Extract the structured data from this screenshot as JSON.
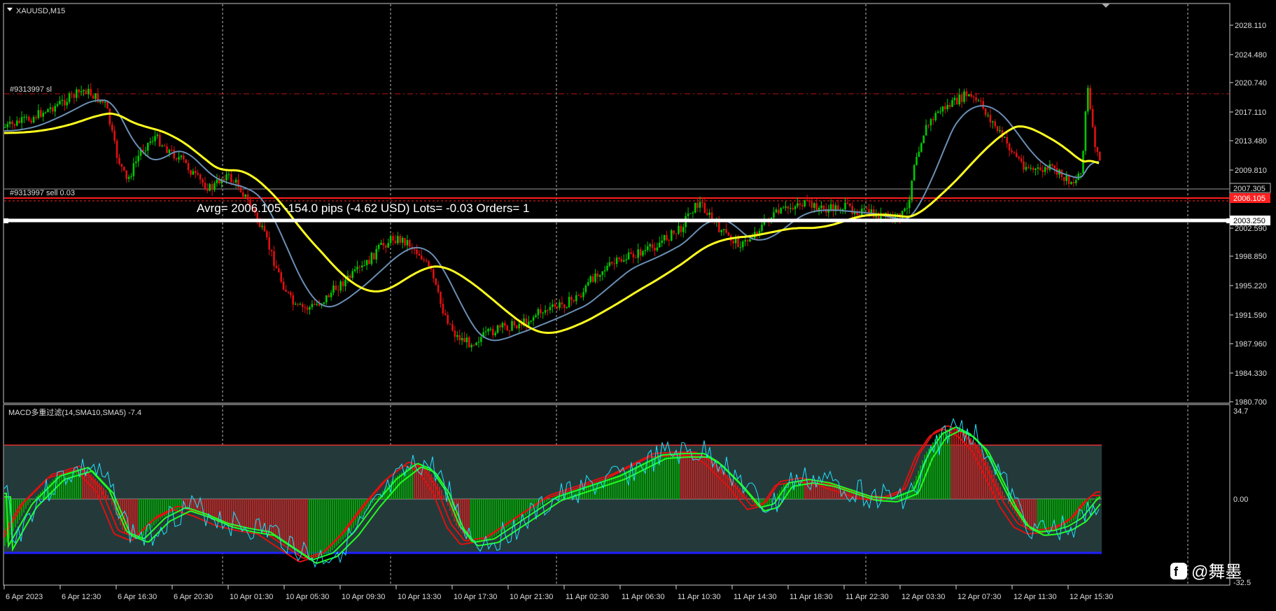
{
  "window": {
    "symbol_title": "XAUUSD,M15"
  },
  "main_chart": {
    "sl_label": "#9313997 sl",
    "sell_label": "#9313997 sell 0.03",
    "avg_info": "Avrg= 2006.105  -154.0 pips (-4.62 USD)  Lots= -0.03  Orders= 1",
    "price_levels": {
      "sl": "2019.8",
      "current": "2007.305",
      "entry": "2006.105",
      "avg": "2003.250"
    },
    "price_ticks": [
      "2028.110",
      "2024.480",
      "2020.740",
      "2017.110",
      "2013.480",
      "2009.810",
      "2002.590",
      "1998.850",
      "1995.220",
      "1991.590",
      "1987.960",
      "1984.330",
      "1980.700"
    ],
    "colors": {
      "bull": "#00c800",
      "bear": "#e01010",
      "ma_fast": "#6a8fb5",
      "ma_slow": "#ffff20",
      "entry_line": "#ff2020",
      "avg_line": "#ffffff"
    }
  },
  "macd_panel": {
    "title": "MACD多重过滤(14,SMA10,SMA5) -7.4",
    "scale": {
      "top": "34.7",
      "zero": "0.00",
      "bottom": "-32.5"
    },
    "colors": {
      "band_fill": "#243a3a",
      "upper_line": "#e03030",
      "lower_line": "#2020ff",
      "signal": "#20e0ff"
    }
  },
  "time_axis": [
    "6 Apr 2023",
    "6 Apr 12:30",
    "6 Apr 16:30",
    "6 Apr 20:30",
    "10 Apr 01:30",
    "10 Apr 05:30",
    "10 Apr 09:30",
    "10 Apr 13:30",
    "10 Apr 17:30",
    "10 Apr 21:30",
    "11 Apr 02:30",
    "11 Apr 06:30",
    "11 Apr 10:30",
    "11 Apr 14:30",
    "11 Apr 18:30",
    "11 Apr 22:30",
    "12 Apr 03:30",
    "12 Apr 07:30",
    "12 Apr 11:30",
    "12 Apr 15:30"
  ],
  "watermark": {
    "text": "@舞墨"
  }
}
